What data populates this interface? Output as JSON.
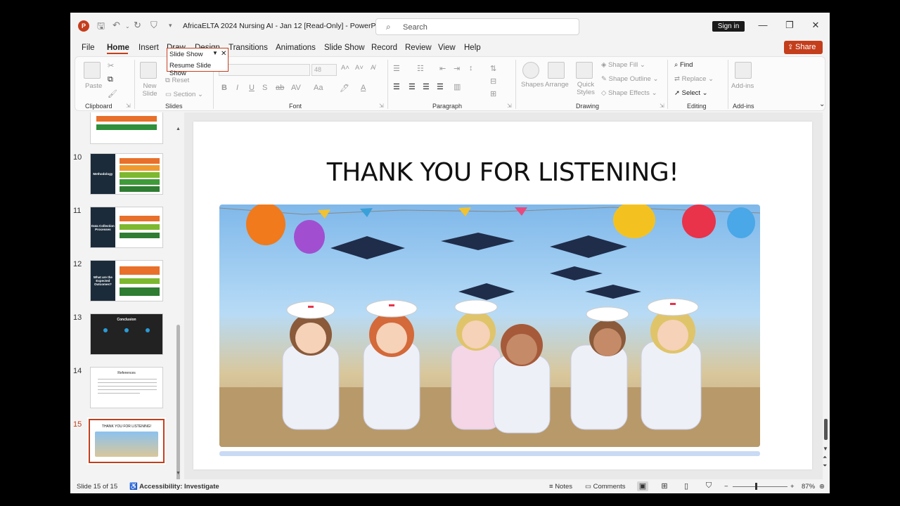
{
  "window": {
    "title": "AfricaELTA 2024 Nursing AI - Jan 12 [Read-Only]  -  PowerP...",
    "app_logo": "P",
    "search_placeholder": "Search",
    "signin_label": "Sign in",
    "share_label": "Share"
  },
  "menu": {
    "tabs": [
      "File",
      "Home",
      "Insert",
      "Draw",
      "Design",
      "Transitions",
      "Animations",
      "Slide Show",
      "Record",
      "Review",
      "View",
      "Help"
    ],
    "active": "Home"
  },
  "popup": {
    "title": "Slide Show",
    "item": "Resume Slide Show"
  },
  "ribbon": {
    "groups": {
      "clipboard": "Clipboard",
      "slides": "Slides",
      "font": "Font",
      "paragraph": "Paragraph",
      "drawing": "Drawing",
      "editing": "Editing",
      "addins": "Add-ins"
    },
    "buttons": {
      "paste": "Paste",
      "new_slide": "New Slide",
      "reset": "Reset",
      "section": "Section",
      "font_size": "48",
      "shapes": "Shapes",
      "arrange": "Arrange",
      "quick_styles": "Quick Styles",
      "shape_fill": "Shape Fill",
      "shape_outline": "Shape Outline",
      "shape_effects": "Shape Effects",
      "find": "Find",
      "replace": "Replace",
      "select": "Select",
      "addins": "Add-ins"
    }
  },
  "slides_pane": {
    "selected": 15,
    "thumbnails": [
      {
        "number": "10",
        "heading": "Methodology"
      },
      {
        "number": "11",
        "heading": "Data Collection Processes"
      },
      {
        "number": "12",
        "heading": "What are the Expected Outcomes?"
      },
      {
        "number": "13",
        "heading": "Conclusion"
      },
      {
        "number": "14",
        "heading": "References"
      },
      {
        "number": "15",
        "heading": "THANK YOU FOR LISTENING!"
      }
    ]
  },
  "slide": {
    "title": "THANK YOU FOR LISTENING!",
    "image_description": "cartoon nurses celebrating with graduation caps and balloons"
  },
  "status_bar": {
    "slide_info": "Slide 15 of 15",
    "accessibility": "Accessibility: Investigate",
    "notes": "Notes",
    "comments": "Comments",
    "zoom": "87%"
  },
  "colors": {
    "accent": "#c43e1c",
    "dark_slide": "#1b2b3a"
  }
}
